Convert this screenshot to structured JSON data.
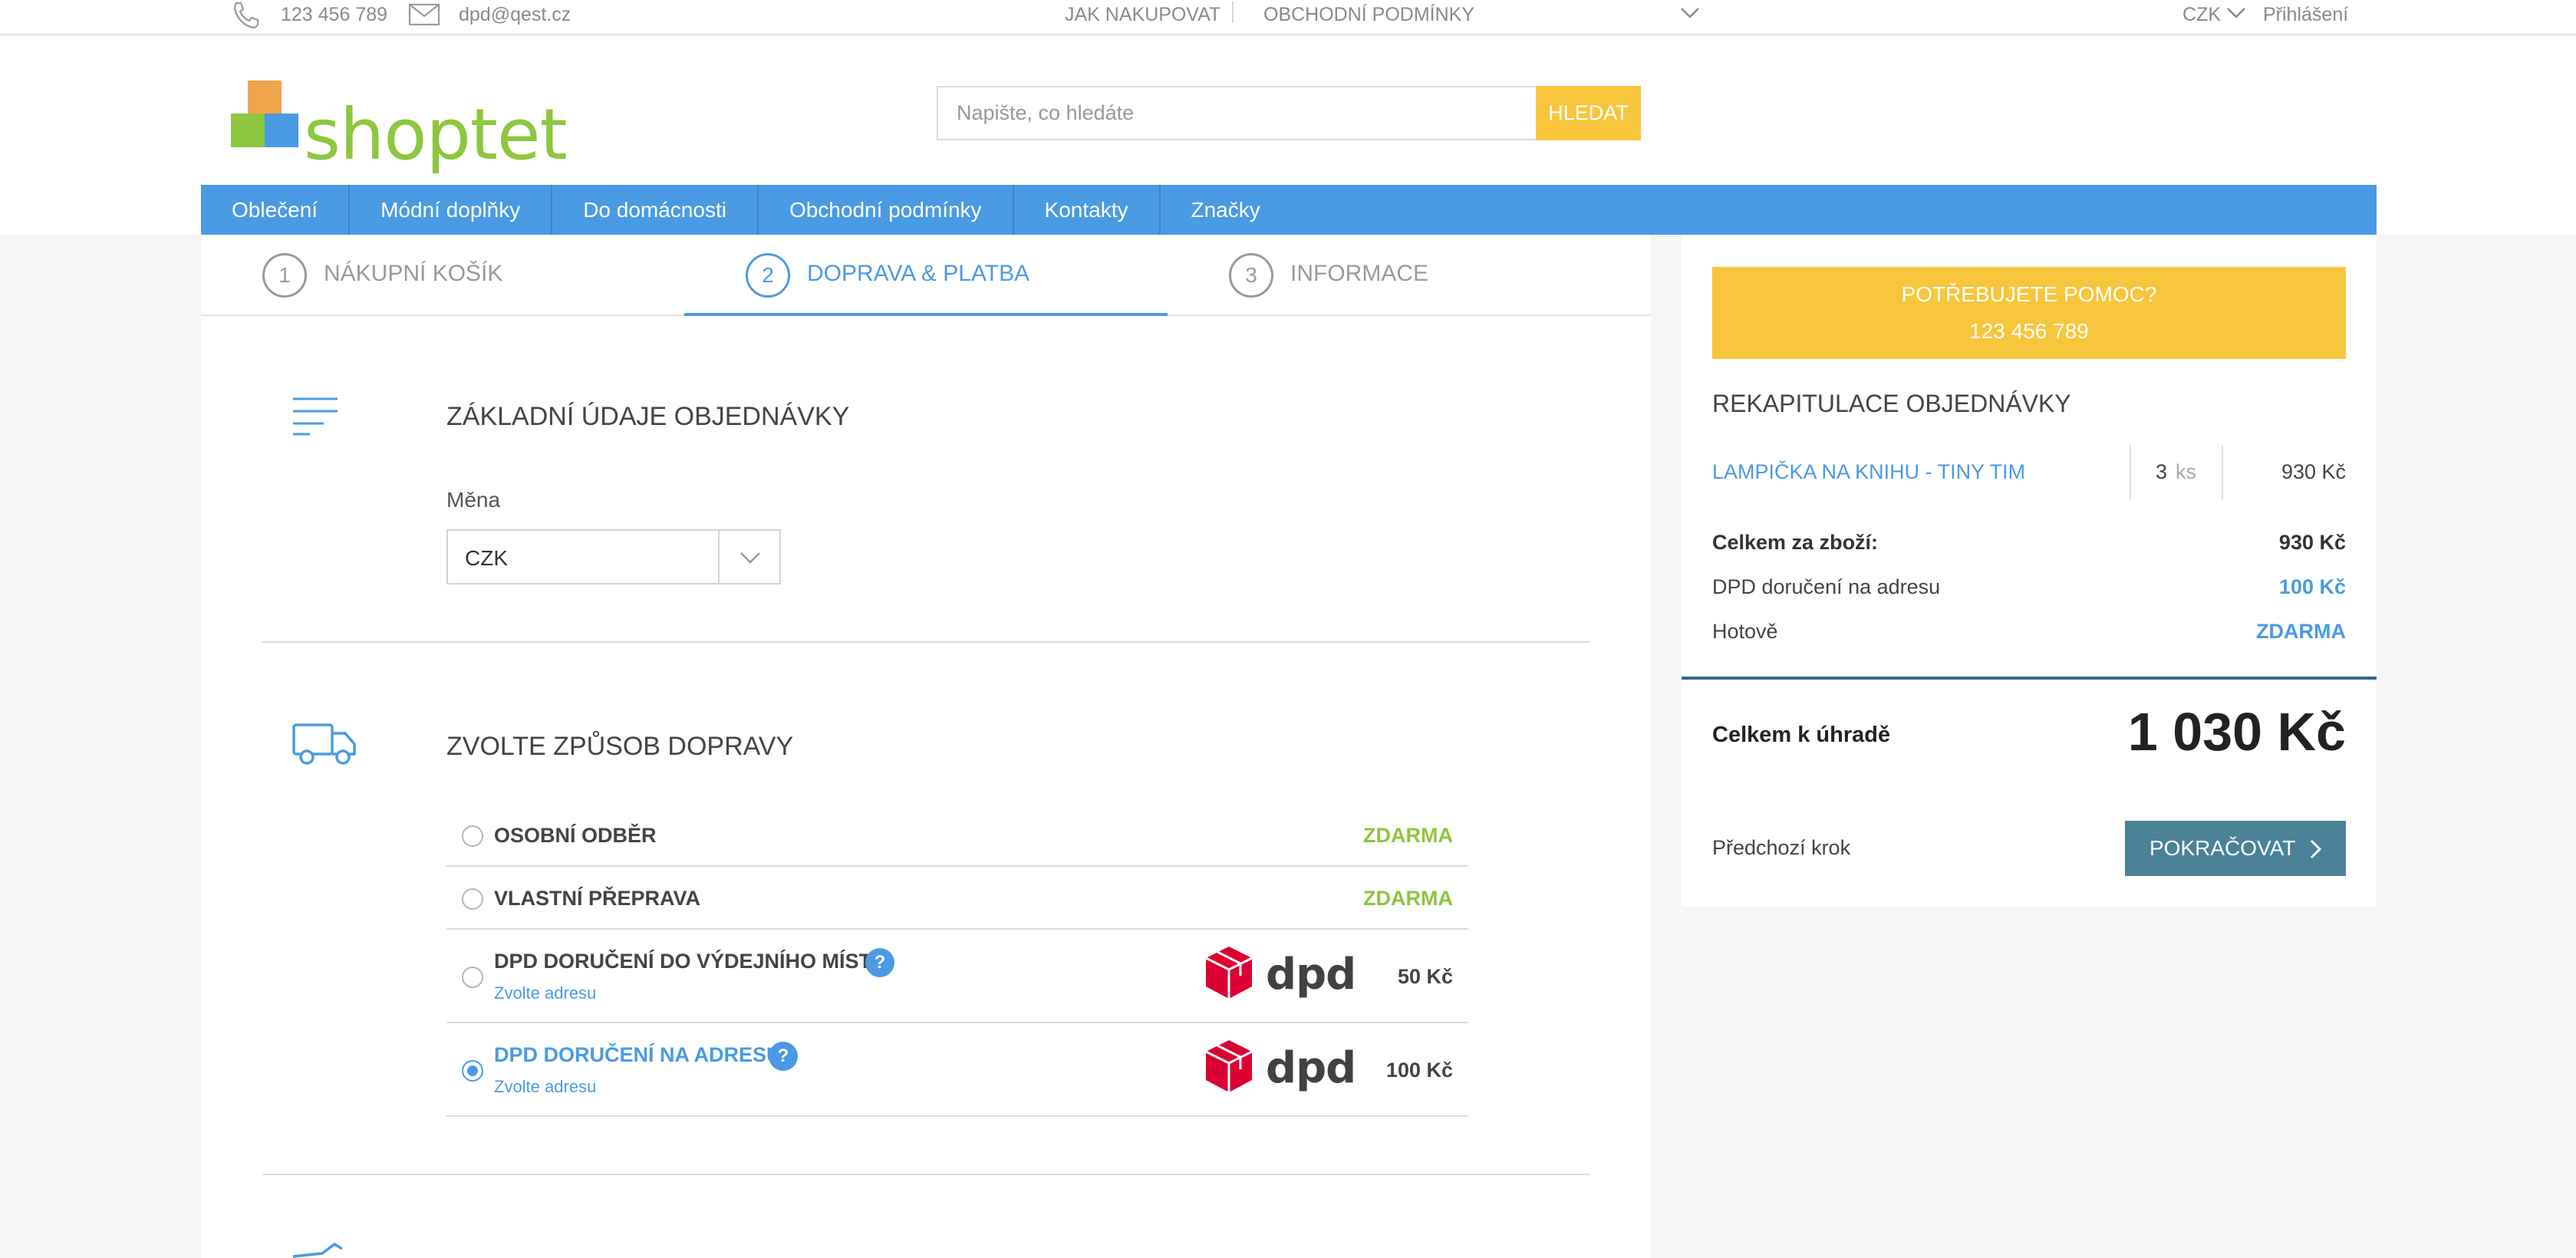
{
  "topbar": {
    "phone": "123 456 789",
    "email": "dpd@qest.cz",
    "links": [
      "JAK NAKUPOVAT",
      "OBCHODNÍ PODMÍNKY"
    ],
    "currency": "CZK",
    "login": "Přihlášení"
  },
  "header": {
    "logo_text": "shoptet",
    "search_placeholder": "Napište, co hledáte",
    "search_button": "HLEDAT"
  },
  "nav": [
    "Oblečení",
    "Módní doplňky",
    "Do domácnosti",
    "Obchodní podmínky",
    "Kontakty",
    "Značky"
  ],
  "steps": [
    {
      "num": "1",
      "label": "NÁKUPNÍ KOŠÍK"
    },
    {
      "num": "2",
      "label": "DOPRAVA & PLATBA"
    },
    {
      "num": "3",
      "label": "INFORMACE"
    }
  ],
  "basic": {
    "title": "ZÁKLADNÍ ÚDAJE OBJEDNÁVKY",
    "currency_label": "Měna",
    "currency_value": "CZK"
  },
  "shipping": {
    "title": "ZVOLTE ZPŮSOB DOPRAVY",
    "options": [
      {
        "name": "OSOBNÍ ODBĚR",
        "price": "ZDARMA"
      },
      {
        "name": "VLASTNÍ PŘEPRAVA",
        "price": "ZDARMA"
      },
      {
        "name": "DPD DORUČENÍ DO VÝDEJNÍHO MÍSTA",
        "sub": "Zvolte adresu",
        "price": "50 Kč"
      },
      {
        "name": "DPD DORUČENÍ NA ADRESU",
        "sub": "Zvolte adresu",
        "price": "100 Kč"
      }
    ],
    "help_glyph": "?",
    "dpd_text": "dpd"
  },
  "sidebar": {
    "help_line1": "POTŘEBUJETE POMOC?",
    "help_line2": "123 456 789",
    "recap_title": "REKAPITULACE OBJEDNÁVKY",
    "item": {
      "name": "LAMPIČKA NA KNIHU - TINY TIM",
      "qty": "3",
      "unit": "ks",
      "price": "930 Kč"
    },
    "goods_total_label": "Celkem za zboží:",
    "goods_total_value": "930 Kč",
    "shipping_label": "DPD doručení na adresu",
    "shipping_value": "100 Kč",
    "payment_label": "Hotově",
    "payment_value": "ZDARMA",
    "total_label": "Celkem k úhradě",
    "total_value": "1 030 Kč",
    "prev_step": "Předchozí krok",
    "continue": "POKRAČOVAT"
  },
  "colors": {
    "accent": "#4a9be3",
    "yellow": "#f8c63d",
    "green": "#8dc63f",
    "continue": "#4b8197",
    "dpd_red": "#dc0032"
  }
}
